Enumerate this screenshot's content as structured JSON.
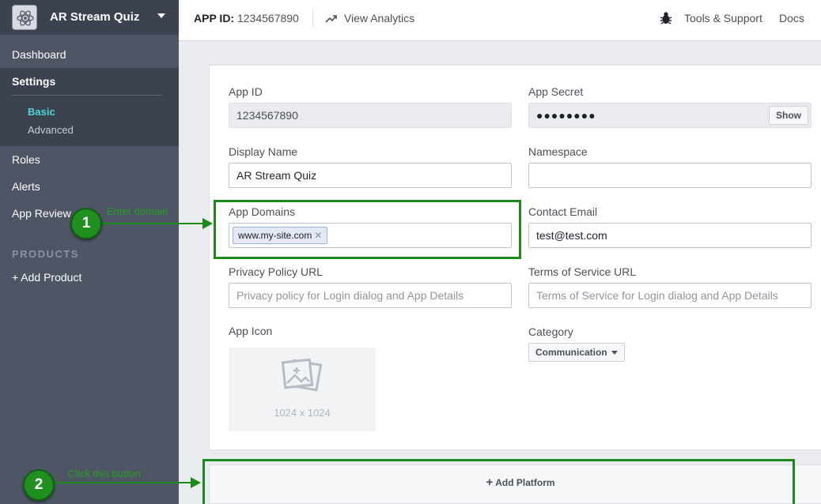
{
  "sidebar": {
    "app_name": "AR Stream Quiz",
    "items": [
      {
        "label": "Dashboard"
      },
      {
        "label": "Settings"
      },
      {
        "label": "Roles"
      },
      {
        "label": "Alerts"
      },
      {
        "label": "App Review"
      }
    ],
    "settings_sub": [
      {
        "label": "Basic",
        "active": true,
        "color": "#4ed4d8"
      },
      {
        "label": "Advanced",
        "active": false,
        "color": "#c9ccd3"
      }
    ],
    "products_heading": "PRODUCTS",
    "add_product": "+ Add Product"
  },
  "topbar": {
    "app_id_label": "APP ID:",
    "app_id_value": "1234567890",
    "view_analytics": "View Analytics",
    "tools_support": "Tools & Support",
    "docs": "Docs"
  },
  "form": {
    "app_id": {
      "label": "App ID",
      "value": "1234567890"
    },
    "app_secret": {
      "label": "App Secret",
      "value": "●●●●●●●●",
      "button": "Show"
    },
    "display_name": {
      "label": "Display Name",
      "value": "AR Stream Quiz"
    },
    "namespace": {
      "label": "Namespace",
      "value": ""
    },
    "app_domains": {
      "label": "App Domains",
      "tokens": [
        "www.my-site.com"
      ]
    },
    "contact_email": {
      "label": "Contact Email",
      "value": "test@test.com"
    },
    "privacy_policy_url": {
      "label": "Privacy Policy URL",
      "placeholder": "Privacy policy for Login dialog and App Details"
    },
    "terms_of_service_url": {
      "label": "Terms of Service URL",
      "placeholder": "Terms of Service for Login dialog and App Details"
    },
    "app_icon": {
      "label": "App Icon",
      "dimensions": "1024 x 1024"
    },
    "category": {
      "label": "Category",
      "value": "Communication"
    }
  },
  "add_platform": {
    "label": "Add Platform"
  },
  "annotations": [
    {
      "number": "1",
      "text": "Enter domain"
    },
    {
      "number": "2",
      "text": "Click this button"
    }
  ],
  "colors": {
    "sidebar_bg": "#4e5665",
    "annotation_green": "#1a8a1a",
    "active_sub_item": "#4ed4d8"
  }
}
